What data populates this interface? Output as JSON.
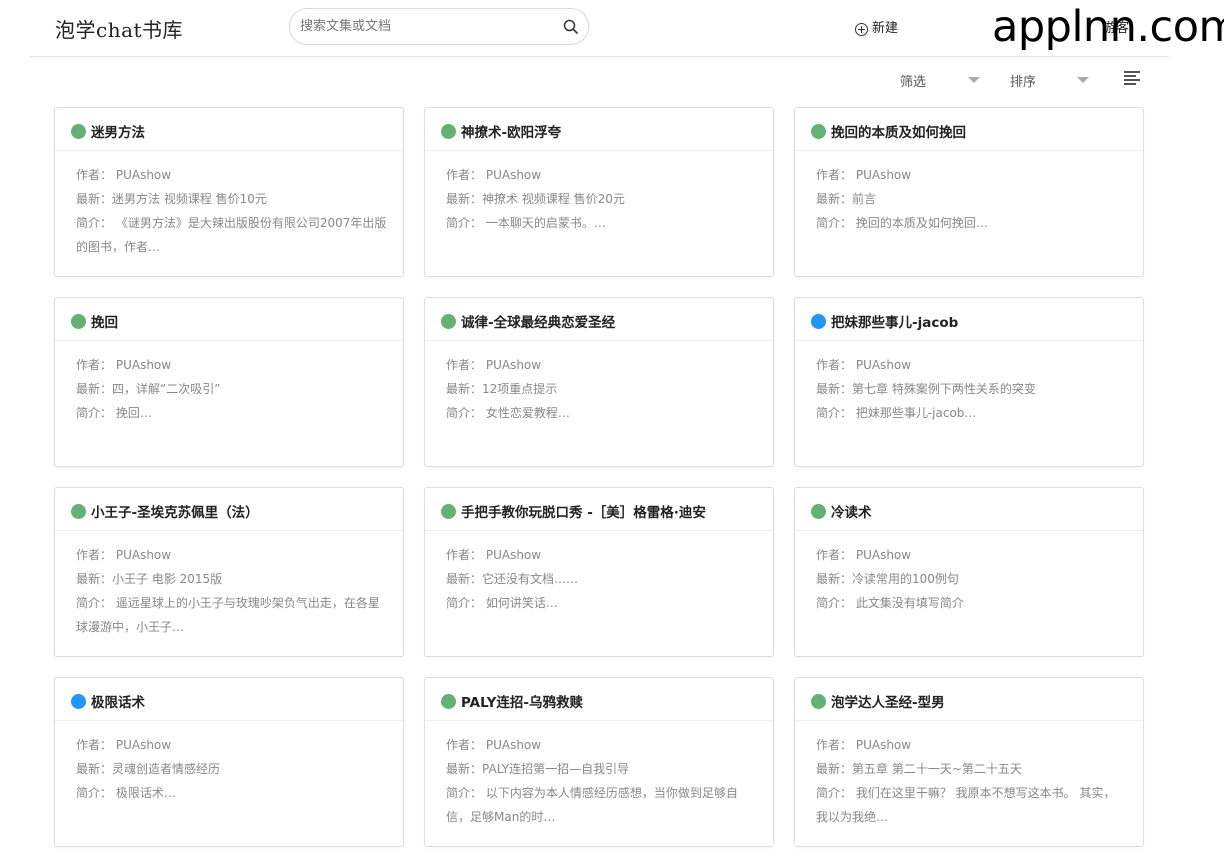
{
  "header": {
    "logo": "泡学chat书库",
    "search_placeholder": "搜索文集或文档",
    "new_label": "新建",
    "user_label": "游客",
    "watermark": "applnn.com"
  },
  "toolbar": {
    "filter_label": "筛选",
    "sort_label": "排序"
  },
  "labels": {
    "author": "作者：",
    "latest": "最新：",
    "intro": "简介："
  },
  "colors": {
    "green_dot": "#63b174",
    "blue_dot": "#2196f3"
  },
  "cards": [
    {
      "title": "迷男方法",
      "dot": "green",
      "author": "PUAshow",
      "latest": "迷男方法 视频课程 售价10元",
      "intro": "《谜男方法》是大辣出版股份有限公司2007年出版的图书，作者…"
    },
    {
      "title": "神撩术-欧阳浮夸",
      "dot": "green",
      "author": "PUAshow",
      "latest": "神撩术 视频课程 售价20元",
      "intro": "一本聊天的启蒙书。…"
    },
    {
      "title": "挽回的本质及如何挽回",
      "dot": "green",
      "author": "PUAshow",
      "latest": "前言",
      "intro": "挽回的本质及如何挽回…"
    },
    {
      "title": "挽回",
      "dot": "green",
      "author": "PUAshow",
      "latest": "四，详解“二次吸引”",
      "intro": "挽回…"
    },
    {
      "title": "诚律-全球最经典恋爱圣经",
      "dot": "green",
      "author": "PUAshow",
      "latest": "12项重点提示",
      "intro": "女性恋爱教程…"
    },
    {
      "title": "把妹那些事儿-jacob",
      "dot": "blue",
      "author": "PUAshow",
      "latest": "第七章 特殊案例下两性关系的突变",
      "intro": "把妹那些事儿-jacob…"
    },
    {
      "title": "小王子-圣埃克苏佩里（法）",
      "dot": "green",
      "author": "PUAshow",
      "latest": "小王子 电影 2015版",
      "intro": "遥远星球上的小王子与玫瑰吵架负气出走，在各星球漫游中，小王子…"
    },
    {
      "title": "手把手教你玩脱口秀 -［美］格雷格·迪安",
      "dot": "green",
      "author": "PUAshow",
      "latest": "它还没有文档……",
      "intro": "如何讲笑话…"
    },
    {
      "title": "冷读术",
      "dot": "green",
      "author": "PUAshow",
      "latest": "冷读常用的100例句",
      "intro": "此文集没有填写简介"
    },
    {
      "title": "极限话术",
      "dot": "blue",
      "author": "PUAshow",
      "latest": "灵魂创造者情感经历",
      "intro": "极限话术…"
    },
    {
      "title": "PALY连招-乌鸦救赎",
      "dot": "green",
      "author": "PUAshow",
      "latest": "PALY连招第一招—自我引导",
      "intro": "以下内容为本人情感经历感想，当你做到足够自信，足够Man的时…"
    },
    {
      "title": "泡学达人圣经-型男",
      "dot": "green",
      "author": "PUAshow",
      "latest": "第五章 第二十一天~第二十五天",
      "intro": "我们在这里干嘛？ 我原本不想写这本书。 其实，我以为我绝…"
    }
  ]
}
